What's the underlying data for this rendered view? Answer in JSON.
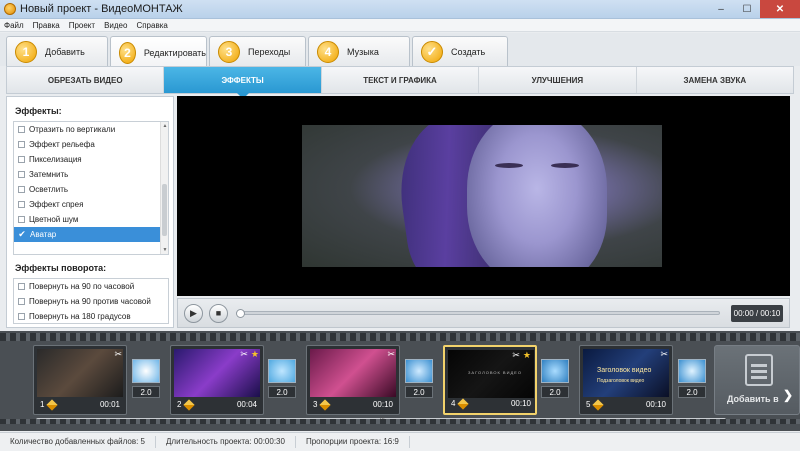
{
  "window": {
    "title": "Новый проект - ВидеоМОНТАЖ",
    "controls": [
      "–",
      "☐",
      "✕"
    ]
  },
  "menu": [
    "Файл",
    "Правка",
    "Проект",
    "Видео",
    "Справка"
  ],
  "steps": [
    {
      "num": "1",
      "label": "Добавить",
      "icon": "step-1-icon"
    },
    {
      "num": "2",
      "label": "Редактировать",
      "icon": "step-2-icon",
      "active": true
    },
    {
      "num": "3",
      "label": "Переходы",
      "icon": "step-3-icon"
    },
    {
      "num": "4",
      "label": "Музыка",
      "icon": "step-4-icon"
    },
    {
      "num": "✓",
      "label": "Создать",
      "icon": "check-icon"
    }
  ],
  "subtabs": [
    "ОБРЕЗАТЬ ВИДЕО",
    "ЭФФЕКТЫ",
    "ТЕКСТ И ГРАФИКА",
    "УЛУЧШЕНИЯ",
    "ЗАМЕНА ЗВУКА"
  ],
  "effects": {
    "title": "Эффекты:",
    "items": [
      {
        "label": "Отразить по вертикали",
        "checked": false
      },
      {
        "label": "Эффект рельефа",
        "checked": false
      },
      {
        "label": "Пикселизация",
        "checked": false
      },
      {
        "label": "Затемнить",
        "checked": false
      },
      {
        "label": "Осветлить",
        "checked": false
      },
      {
        "label": "Эффект спрея",
        "checked": false
      },
      {
        "label": "Цветной шум",
        "checked": false
      },
      {
        "label": "Аватар",
        "checked": true,
        "selected": true
      }
    ]
  },
  "rotation": {
    "title": "Эффекты поворота:",
    "items": [
      {
        "label": "Повернуть на 90 по часовой",
        "checked": false
      },
      {
        "label": "Повернуть на 90 против часовой",
        "checked": false
      },
      {
        "label": "Повернуть на 180 градусов",
        "checked": false
      }
    ]
  },
  "player": {
    "time": "00:00 / 00:10",
    "progress": 0,
    "play_icon": "play-icon",
    "stop_icon": "stop-icon"
  },
  "timeline": {
    "clips": [
      {
        "num": "1",
        "duration": "00:01",
        "favorite": false,
        "colors": [
          "#2a2a2a",
          "#5b4a3d",
          "#1c1c1c"
        ]
      },
      {
        "num": "2",
        "duration": "00:04",
        "favorite": true,
        "colors": [
          "#2a1a6e",
          "#8a3cc9",
          "#1a0f4a"
        ]
      },
      {
        "num": "3",
        "duration": "00:10",
        "favorite": false,
        "colors": [
          "#6a1a4a",
          "#d05090",
          "#3a0a25"
        ]
      },
      {
        "num": "4",
        "duration": "00:10",
        "favorite": true,
        "colors": [
          "#050505",
          "#151515",
          "#050505"
        ]
      },
      {
        "num": "5",
        "duration": "00:10",
        "favorite": false,
        "colors": [
          "#0a1a40",
          "#233f7a",
          "#0a0f25"
        ]
      }
    ],
    "transitions": [
      {
        "duration": "2.0",
        "colors": [
          "#6fb6e8",
          "#ffffff"
        ]
      },
      {
        "duration": "2.0",
        "colors": [
          "#4fa8e0",
          "#bfe6ff"
        ]
      },
      {
        "duration": "2.0",
        "colors": [
          "#3a8fd0",
          "#cfeaff"
        ]
      },
      {
        "duration": "2.0",
        "colors": [
          "#2f7fc0",
          "#a9dcff"
        ]
      },
      {
        "duration": "2.0",
        "colors": [
          "#3a8fd0",
          "#e0f3ff"
        ]
      }
    ],
    "clip5_text": "Заголовок видео",
    "clip5_subtext": "Подзаголовок видео",
    "clip4_text": "ЗАГОЛОВОК ВИДЕО",
    "add_label": "Добавить в",
    "nav_arrow": "❯"
  },
  "status": {
    "files": "Количество добавленных файлов: 5",
    "duration": "Длительность проекта: 00:00:30",
    "ratio": "Пропорции проекта: 16:9"
  }
}
